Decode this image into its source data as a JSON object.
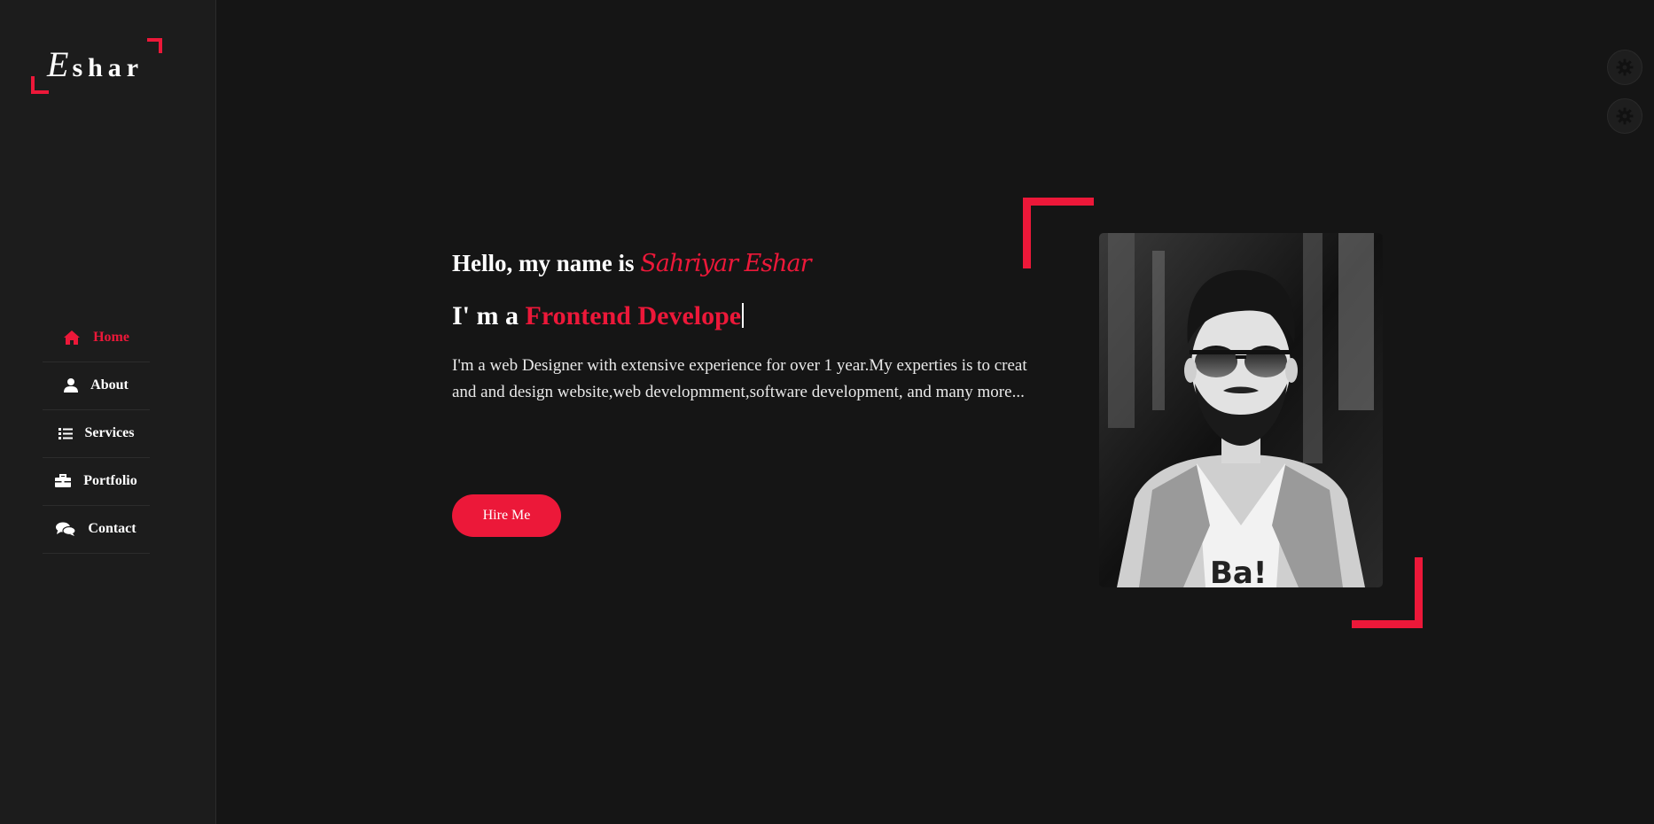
{
  "logo": {
    "first_letter": "E",
    "rest": "shar"
  },
  "nav": {
    "items": [
      {
        "label": "Home",
        "icon": "home-icon",
        "active": true
      },
      {
        "label": "About",
        "icon": "user-icon",
        "active": false
      },
      {
        "label": "Services",
        "icon": "list-icon",
        "active": false
      },
      {
        "label": "Portfolio",
        "icon": "briefcase-icon",
        "active": false
      },
      {
        "label": "Contact",
        "icon": "comments-icon",
        "active": false
      }
    ]
  },
  "hero": {
    "greeting": "Hello, my name is",
    "name": "Sahriyar Eshar",
    "role_prefix": "I' m a",
    "role_typed": "Frontend Develope",
    "description": "I'm a web Designer with extensive experience for over 1 year.My experties is to creat and and design website,web developmment,software development, and many more...",
    "hire_button": "Hire Me"
  },
  "colors": {
    "accent": "#ec1839",
    "background": "#151515",
    "sidebar": "#1c1c1c",
    "text": "#ffffff"
  },
  "settings_buttons": [
    "gear-icon",
    "gear-icon"
  ]
}
